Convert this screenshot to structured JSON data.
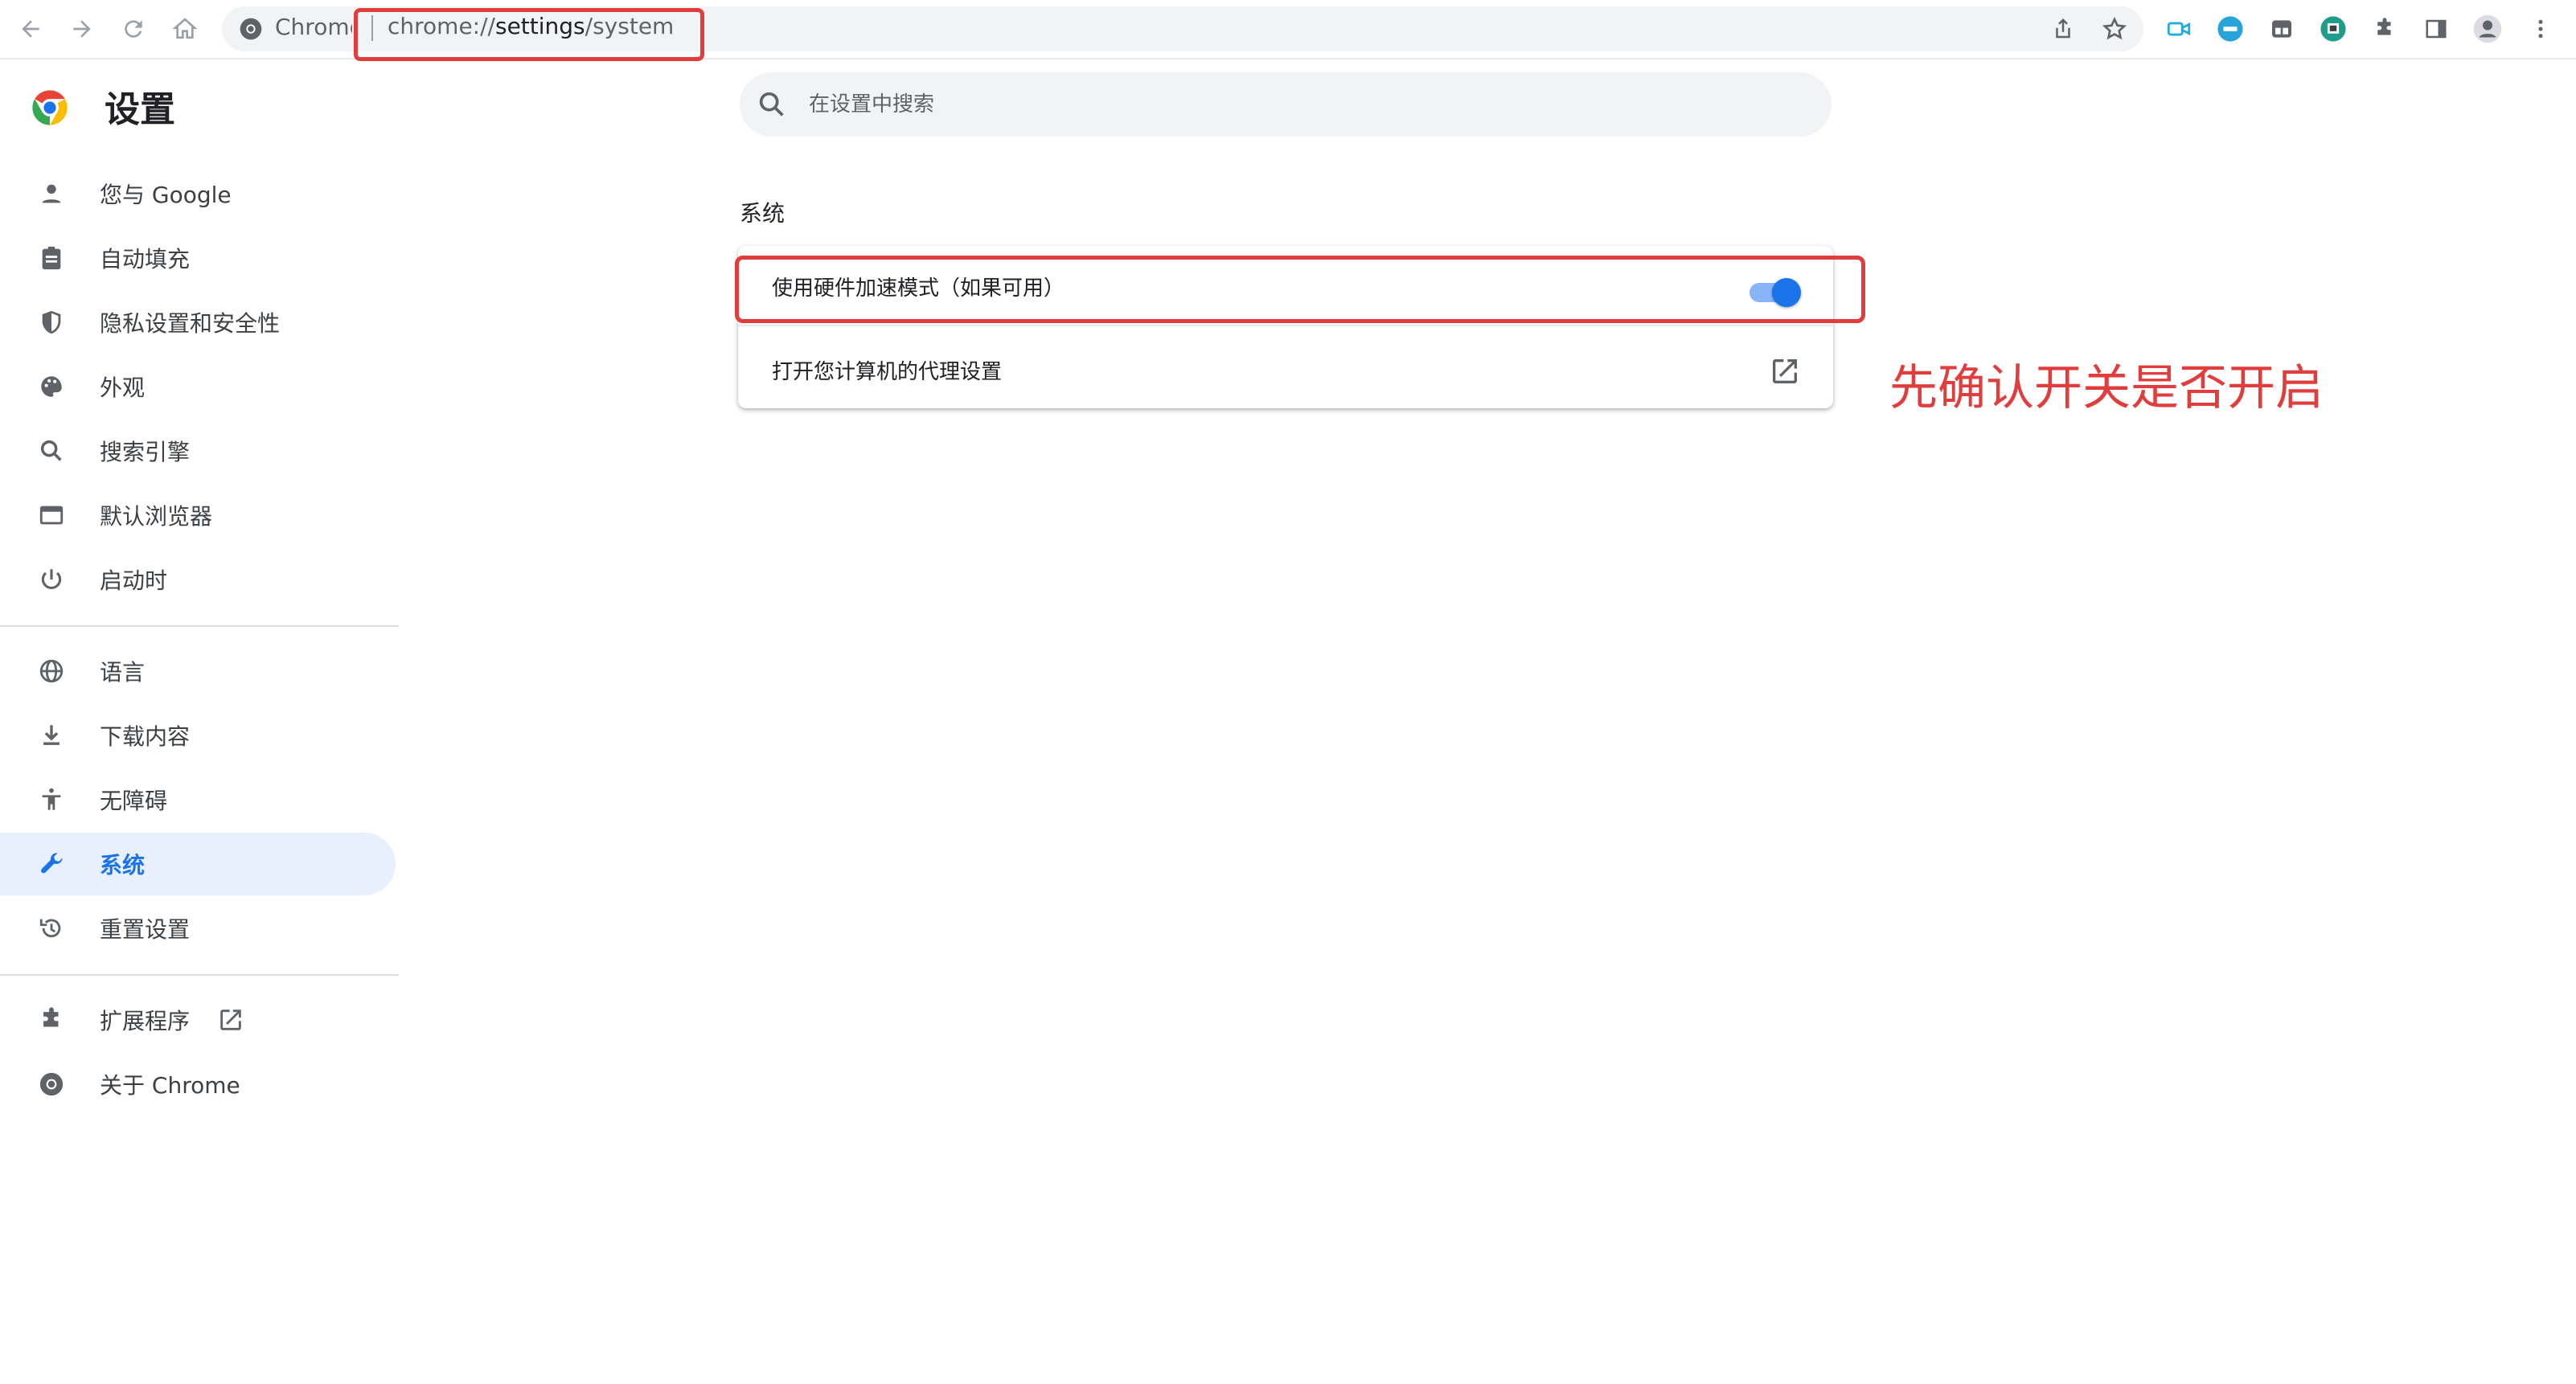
{
  "toolbar": {
    "site_chip": "Chrome",
    "url_host": "chrome://settings/system",
    "url_prefix": "chrome://",
    "url_strong": "settings",
    "url_suffix": "/system"
  },
  "sidebar": {
    "title": "设置",
    "items": [
      {
        "label": "您与 Google",
        "icon": "person-icon"
      },
      {
        "label": "自动填充",
        "icon": "clipboard-icon"
      },
      {
        "label": "隐私设置和安全性",
        "icon": "shield-icon"
      },
      {
        "label": "外观",
        "icon": "palette-icon"
      },
      {
        "label": "搜索引擎",
        "icon": "search-icon"
      },
      {
        "label": "默认浏览器",
        "icon": "browser-window-icon"
      },
      {
        "label": "启动时",
        "icon": "power-icon"
      },
      {
        "label": "语言",
        "icon": "globe-icon"
      },
      {
        "label": "下载内容",
        "icon": "download-icon"
      },
      {
        "label": "无障碍",
        "icon": "accessibility-icon"
      },
      {
        "label": "系统",
        "icon": "wrench-icon",
        "active": true
      },
      {
        "label": "重置设置",
        "icon": "restore-icon"
      },
      {
        "label": "扩展程序",
        "icon": "puzzle-icon"
      },
      {
        "label": "关于 Chrome",
        "icon": "chrome-icon"
      }
    ]
  },
  "search": {
    "placeholder": "在设置中搜索"
  },
  "main": {
    "section_title": "系统",
    "rows": [
      {
        "label": "使用硬件加速模式（如果可用）",
        "control": "toggle",
        "state": "on"
      },
      {
        "label": "打开您计算机的代理设置",
        "control": "external-link"
      }
    ]
  },
  "annotation": "先确认开关是否开启",
  "colors": {
    "accent": "#1a73e8",
    "annotation_red": "#e23d3d",
    "active_bg": "#e8f0fe"
  }
}
